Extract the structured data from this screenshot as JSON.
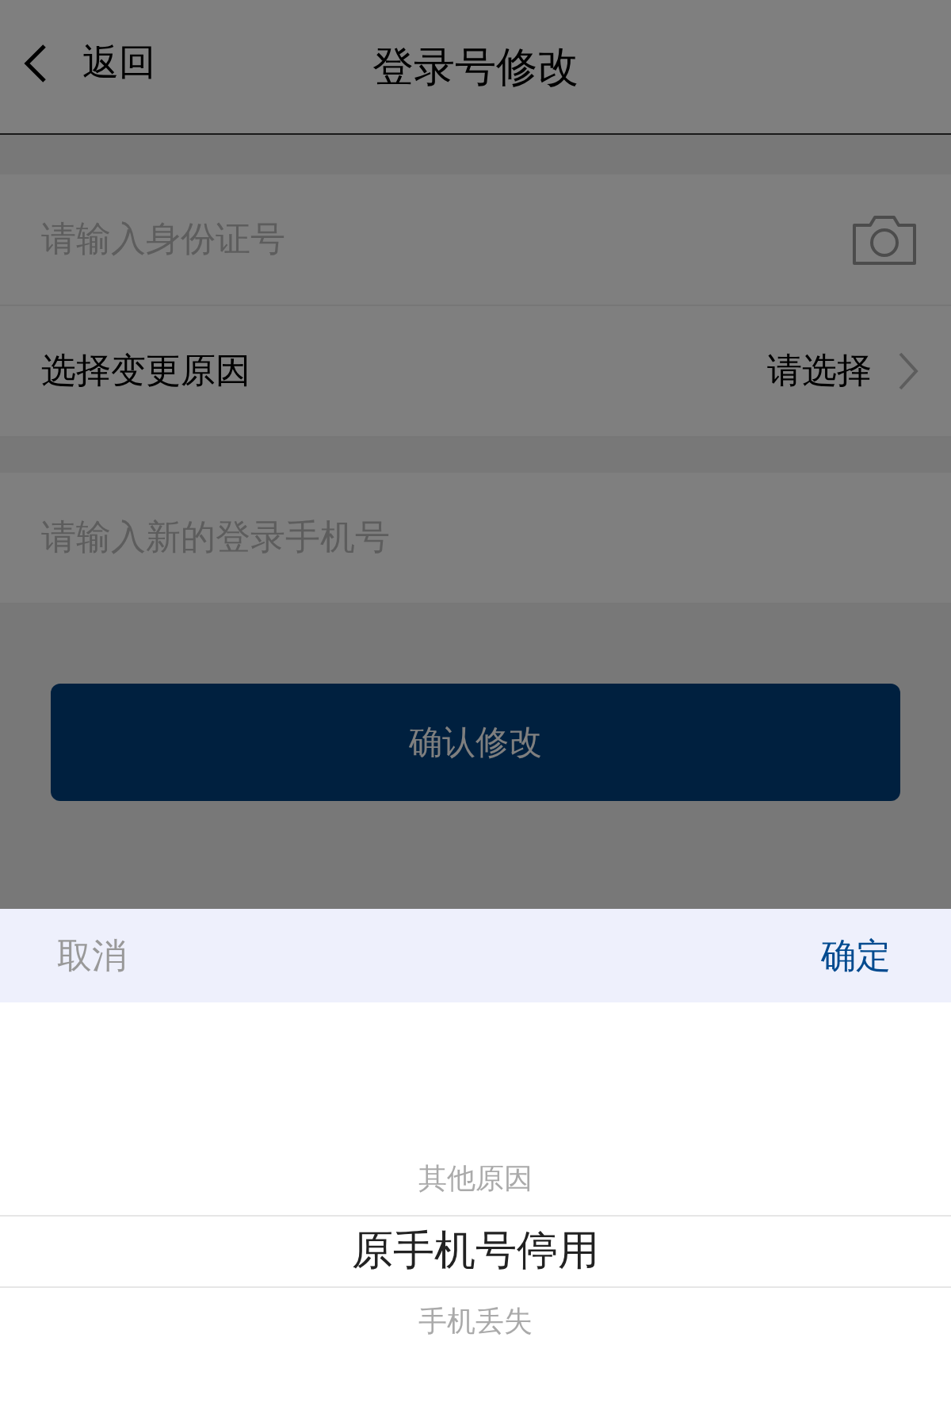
{
  "nav": {
    "back": "返回",
    "title": "登录号修改"
  },
  "form": [
    {
      "kind": "input",
      "placeholder": "请输入身份证号",
      "camera": true
    },
    {
      "kind": "select",
      "label": "选择变更原因",
      "value": "请选择"
    },
    {
      "kind": "input",
      "placeholder": "请输入新的登录手机号",
      "camera": false
    }
  ],
  "submit": "确认修改",
  "picker": {
    "cancel": "取消",
    "confirm": "确定",
    "options": [
      {
        "label": "其他原因",
        "selected": false
      },
      {
        "label": "原手机号停用",
        "selected": true
      },
      {
        "label": "手机丢失",
        "selected": false
      }
    ]
  }
}
